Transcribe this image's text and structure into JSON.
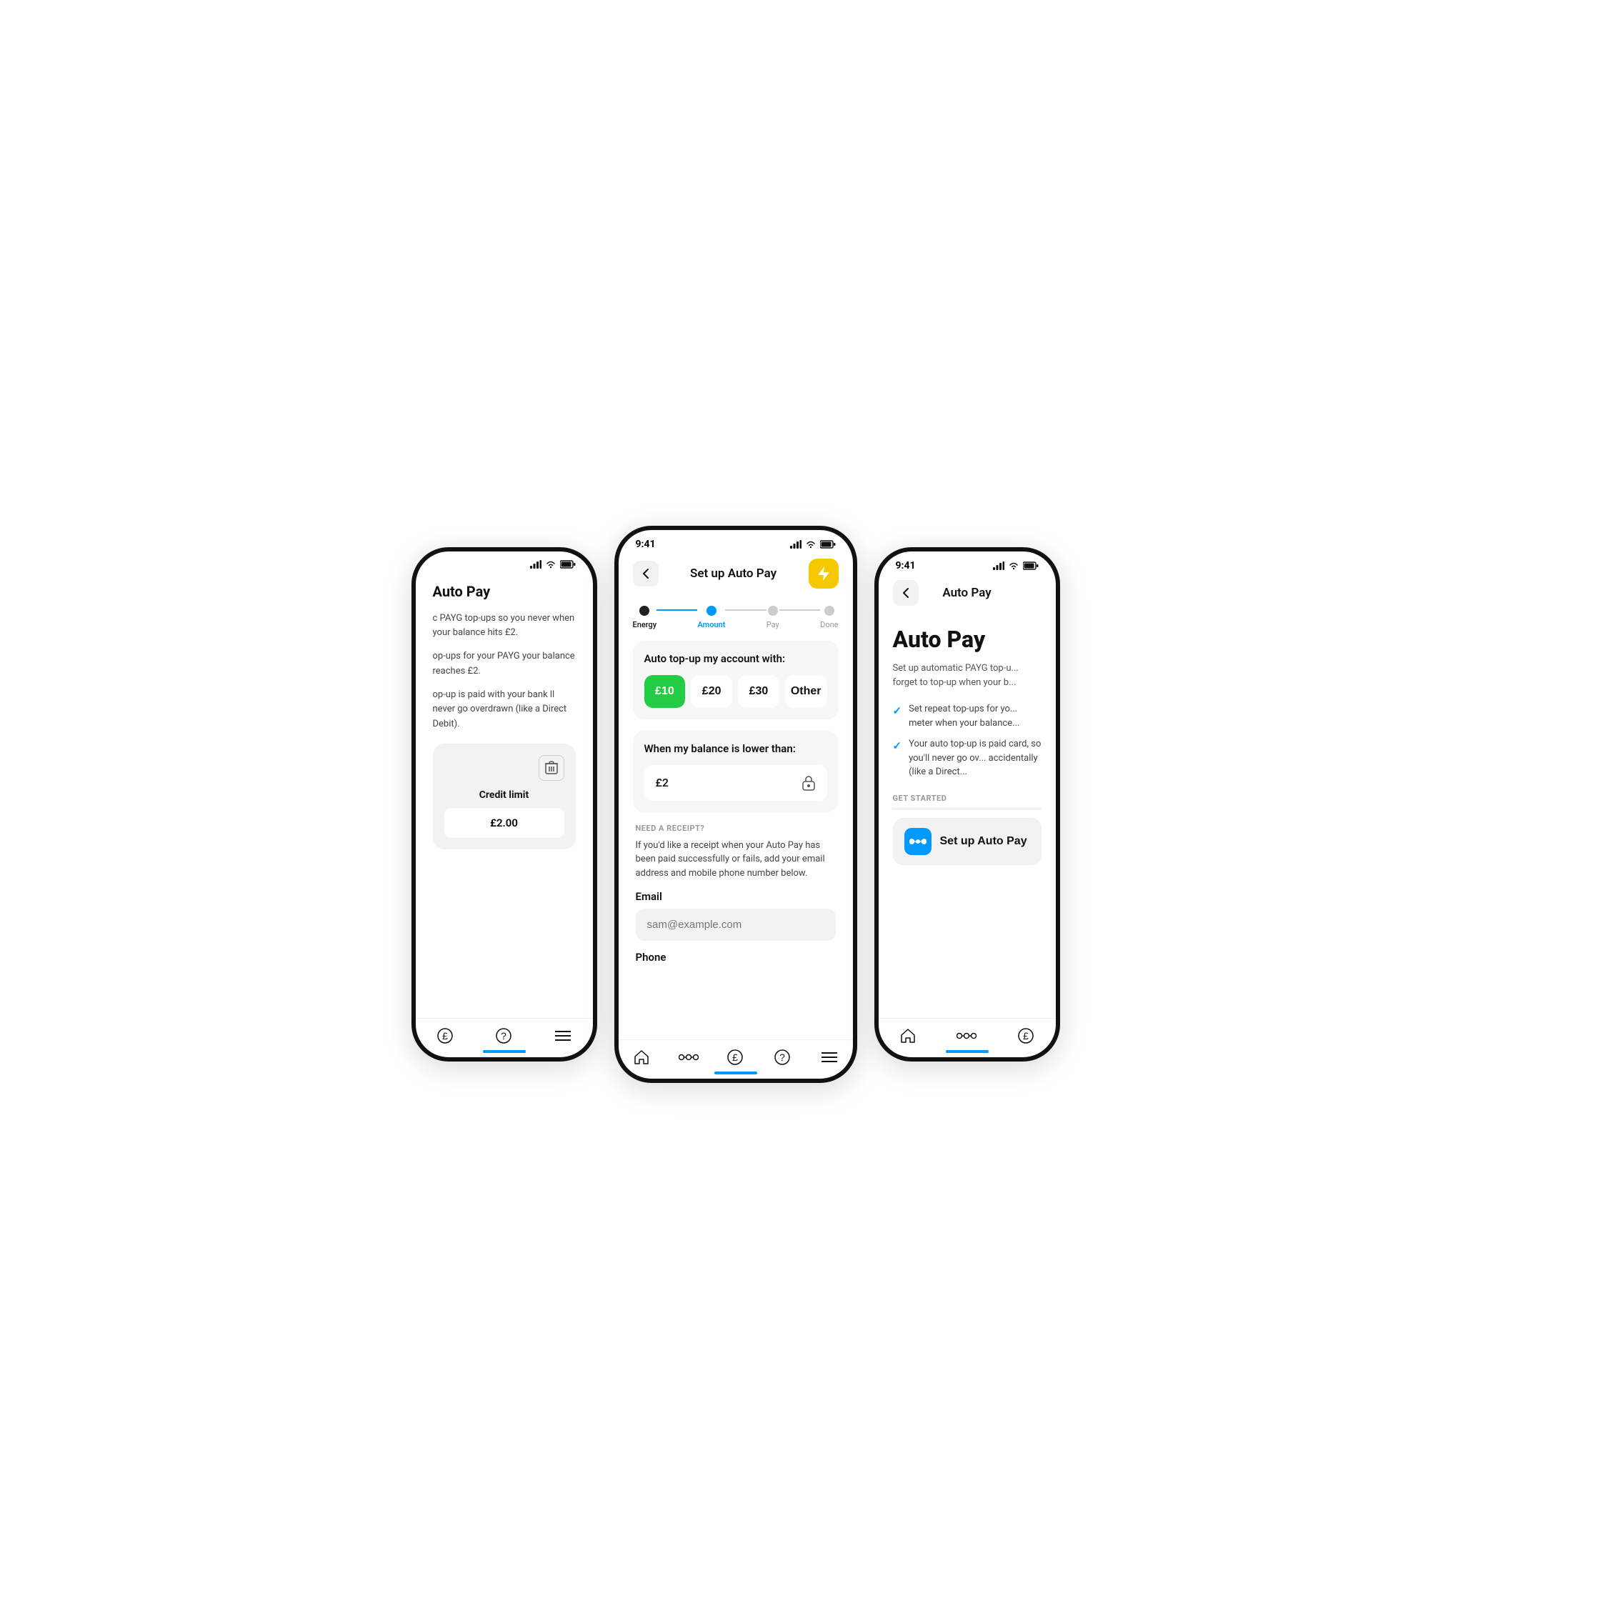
{
  "phones": {
    "left": {
      "status": {
        "time": "",
        "signal": "signal",
        "wifi": "wifi",
        "battery": "battery"
      },
      "title": "Auto Pay",
      "body_texts": [
        "c PAYG top-ups so you never when your balance hits £2.",
        "op-ups for your PAYG your balance reaches £2.",
        "op-up is paid with your bank ll never go overdrawn (like a Direct Debit)."
      ],
      "credit_section": {
        "trash_icon": "trash-icon",
        "label": "Credit limit",
        "value": "£2.00"
      },
      "nav_icons": [
        "pound-icon",
        "help-icon",
        "menu-icon"
      ]
    },
    "center": {
      "status": {
        "time": "9:41",
        "signal": "signal",
        "wifi": "wifi",
        "battery": "battery"
      },
      "nav": {
        "back_label": "←",
        "title": "Set up Auto Pay",
        "action_icon": "lightning-icon"
      },
      "stepper": {
        "steps": [
          {
            "label": "Energy",
            "state": "done"
          },
          {
            "label": "Amount",
            "state": "active"
          },
          {
            "label": "Pay",
            "state": "inactive"
          },
          {
            "label": "Done",
            "state": "inactive"
          }
        ]
      },
      "top_up_card": {
        "title": "Auto top-up my account with:",
        "amounts": [
          {
            "value": "£10",
            "selected": true
          },
          {
            "value": "£20",
            "selected": false
          },
          {
            "value": "£30",
            "selected": false
          },
          {
            "value": "Other",
            "selected": false
          }
        ]
      },
      "balance_card": {
        "title": "When my balance is lower than:",
        "value": "£2",
        "lock_icon": "lock-icon"
      },
      "receipt_section": {
        "heading": "NEED A RECEIPT?",
        "description": "If you'd like a receipt when your Auto Pay has been paid successfully or fails, add your email address and mobile phone number below.",
        "email_label": "Email",
        "email_placeholder": "sam@example.com",
        "phone_label": "Phone"
      },
      "nav_icons": [
        "home-icon",
        "connect-icon",
        "pound-icon",
        "help-icon",
        "menu-icon"
      ]
    },
    "right": {
      "status": {
        "time": "9:41",
        "signal": "signal",
        "wifi": "wifi",
        "battery": "battery"
      },
      "nav": {
        "back_label": "←",
        "title": "Auto Pay"
      },
      "big_title": "Auto Pay",
      "description": "Set up automatic PAYG top-u... forget to top-up when your b...",
      "checklist": [
        "Set repeat top-ups for yo... meter when your balance...",
        "Your auto top-up is paid card, so you'll never go ov... accidentally (like a Direct..."
      ],
      "get_started_label": "GET STARTED",
      "setup_button": {
        "icon": "infinity-icon",
        "label": "Set up Auto Pay"
      },
      "nav_icons": [
        "home-icon",
        "connect-icon",
        "pound-icon"
      ]
    }
  },
  "colors": {
    "accent_blue": "#0099ff",
    "accent_green": "#22cc44",
    "accent_yellow": "#f5c800",
    "text_dark": "#111111",
    "text_muted": "#999999",
    "bg_light": "#f7f7f7"
  }
}
